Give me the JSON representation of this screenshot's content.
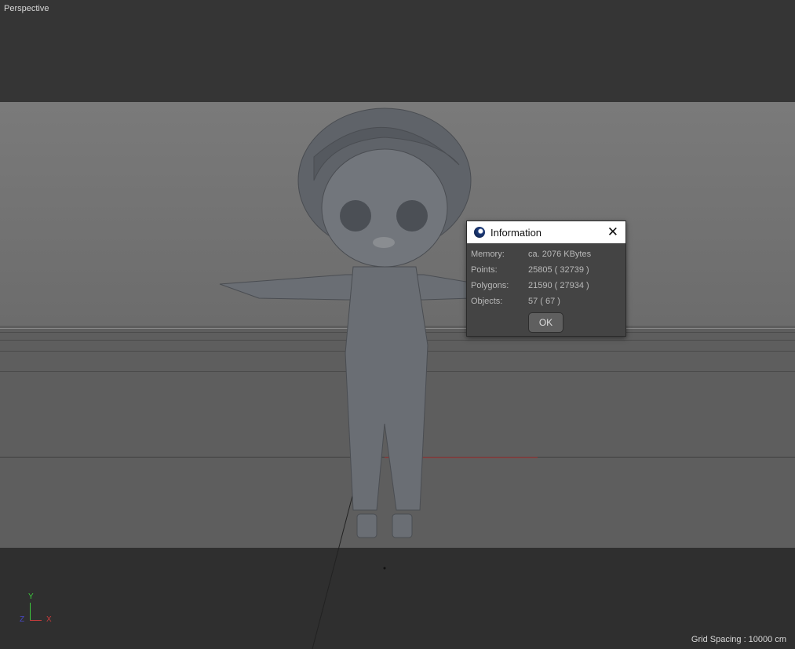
{
  "viewport": {
    "label": "Perspective",
    "grid_spacing": "Grid Spacing : 10000 cm"
  },
  "axes": {
    "y": "Y",
    "z": "Z",
    "x": "X",
    "colors": {
      "x": "#c83c3c",
      "y": "#3cc83c",
      "z": "#3c3cc8"
    }
  },
  "dialog": {
    "title": "Information",
    "rows": [
      {
        "label": "Memory:",
        "value": "ca. 2076 KBytes"
      },
      {
        "label": "Points:",
        "value": "25805 ( 32739 )"
      },
      {
        "label": "Polygons:",
        "value": "21590 ( 27934 )"
      },
      {
        "label": "Objects:",
        "value": "57 ( 67 )"
      }
    ],
    "ok_label": "OK"
  }
}
